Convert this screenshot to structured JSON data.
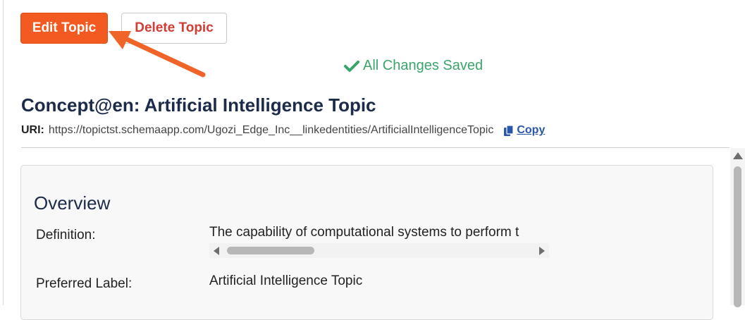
{
  "toolbar": {
    "edit_label": "Edit Topic",
    "delete_label": "Delete Topic"
  },
  "status": {
    "saved_text": "All Changes Saved",
    "icon": "check-icon"
  },
  "header": {
    "title": "Concept@en: Artificial Intelligence Topic",
    "uri_label": "URI:",
    "uri_value": "https://topictst.schemaapp.com/Ugozi_Edge_Inc__linkedentities/ArtificialIntelligenceTopic",
    "copy_label": "Copy",
    "copy_icon": "copy-icon"
  },
  "overview": {
    "heading": "Overview",
    "rows": [
      {
        "label": "Definition:",
        "value": "The capability of computational systems to perform t"
      },
      {
        "label": "Preferred Label:",
        "value": "Artificial Intelligence Topic"
      }
    ]
  },
  "colors": {
    "accent": "#f25a22",
    "danger": "#d33b35",
    "success": "#3aa56a",
    "heading": "#1c2b4a",
    "link": "#2a57a8"
  }
}
